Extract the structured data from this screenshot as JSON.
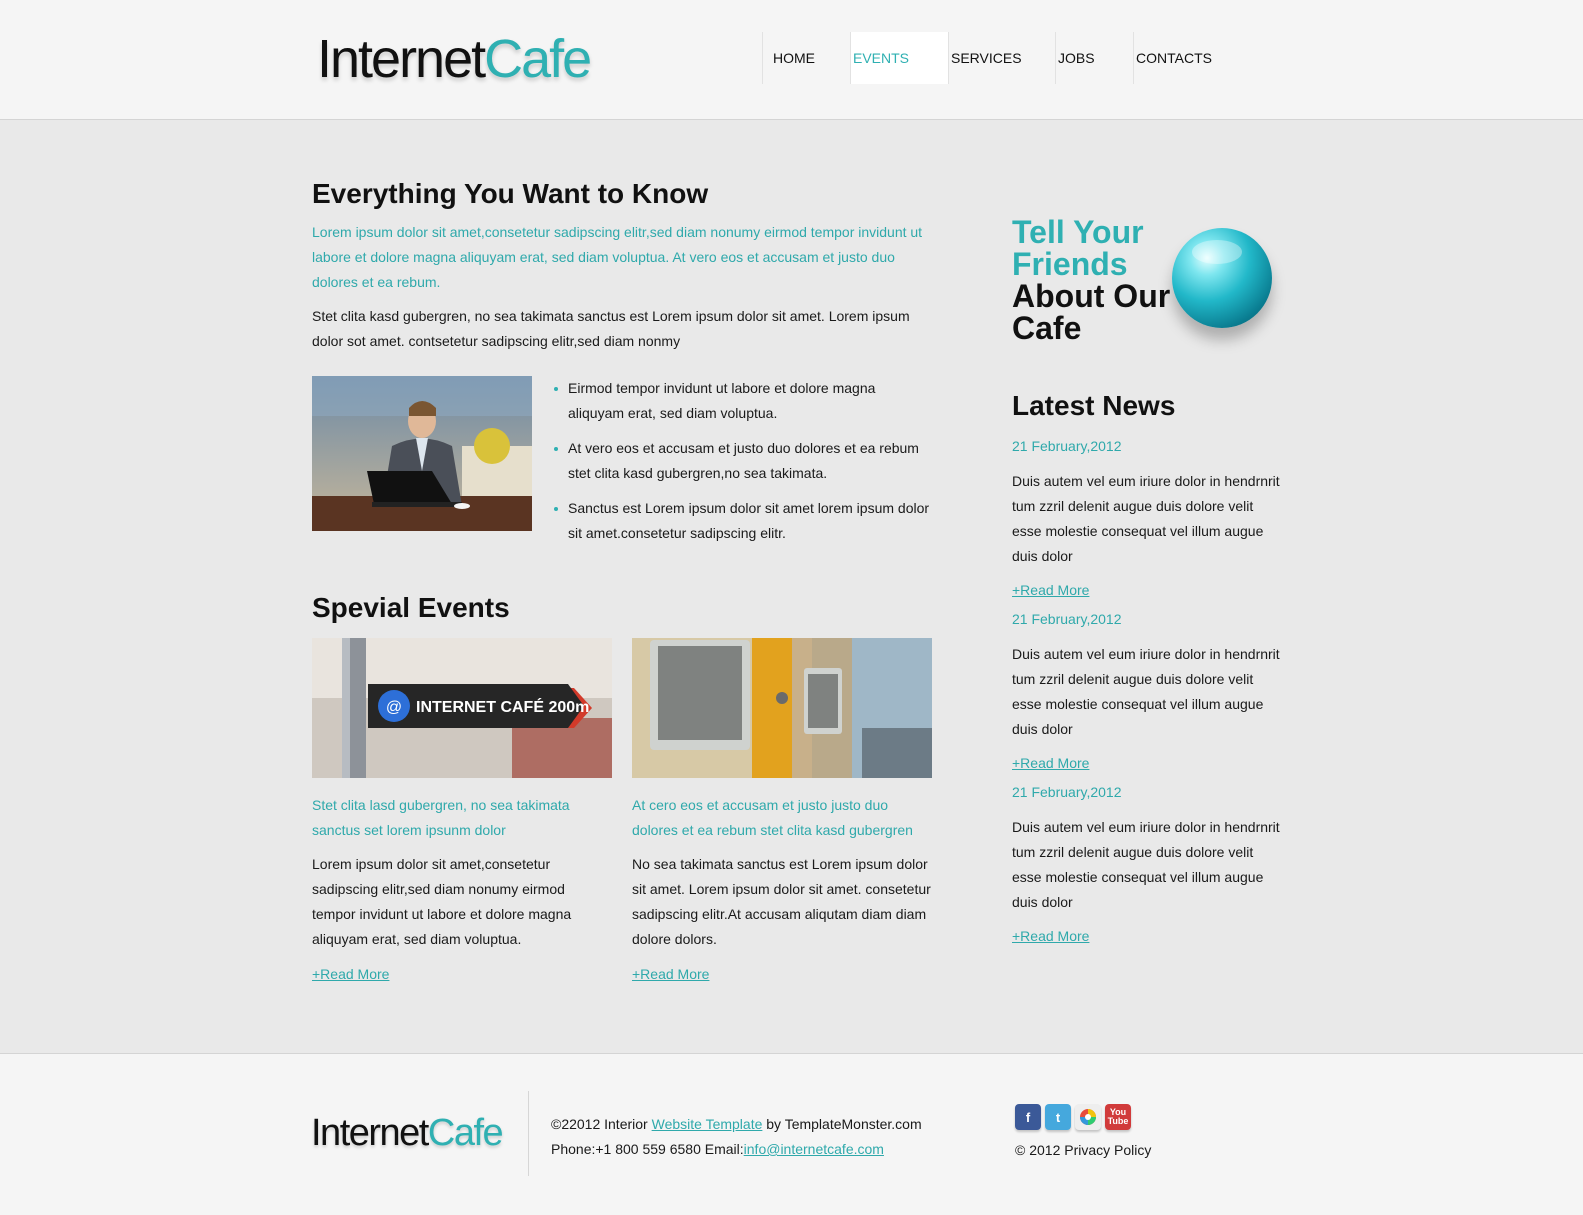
{
  "header": {
    "logo": {
      "part1": "Internet",
      "part2": "Cafe"
    },
    "nav": [
      {
        "label": "HOME"
      },
      {
        "label": "EVENTS"
      },
      {
        "label": "SERVICES"
      },
      {
        "label": "JOBS"
      },
      {
        "label": "CONTACTS"
      }
    ],
    "active_nav": "EVENTS"
  },
  "main": {
    "title": "Everything You Want to Know",
    "lead": "Lorem ipsum dolor sit amet,consetetur sadipscing elitr,sed diam nonumy eirmod tempor invidunt ut labore et dolore magna aliquyam erat, sed diam voluptua. At vero eos et accusam et justo duo dolores et ea rebum.",
    "paragraph": "Stet clita kasd gubergren, no sea takimata sanctus est Lorem ipsum dolor sit amet. Lorem ipsum dolor sot amet. contsetetur sadipscing elitr,sed diam nonmy",
    "bullets": [
      "Eirmod tempor invidunt ut labore et dolore magna aliquyam erat, sed diam voluptua.",
      "At vero eos et accusam et justo duo dolores et ea rebum stet clita kasd gubergren,no sea takimata.",
      "Sanctus est Lorem ipsum dolor sit amet lorem ipsum dolor sit amet.consetetur sadipscing elitr."
    ],
    "events_title": "Spevial Events",
    "events": [
      {
        "image_sign": "INTERNET CAFÉ 200m",
        "image_at": "@",
        "subtitle": "Stet clita lasd gubergren, no sea takimata sanctus set lorem ipsunm dolor",
        "text": "Lorem ipsum dolor sit amet,consetetur sadipscing elitr,sed diam nonumy eirmod tempor invidunt ut labore et dolore magna aliquyam erat, sed diam voluptua.",
        "read_more": "+Read More"
      },
      {
        "subtitle": "At cero eos et accusam et justo justo duo dolores et ea rebum stet clita kasd gubergren",
        "text": "No sea takimata sanctus est Lorem ipsum dolor sit amet. Lorem ipsum dolor sit amet. consetetur sadipscing elitr.At accusam aliqutam diam diam dolore dolors.",
        "read_more": "+Read More"
      }
    ]
  },
  "sidebar": {
    "tell_line1": "Tell Your",
    "tell_line2": "Friends",
    "tell_line3": "About Our",
    "tell_line4": "Cafe",
    "news_title": "Latest News",
    "news": [
      {
        "date": "21 February,2012",
        "text": "Duis autem vel eum iriure dolor in hendrnrit tum zzril delenit augue duis dolore velit esse molestie consequat vel illum augue duis dolor",
        "read_more": "+Read More"
      },
      {
        "date": "21 February,2012",
        "text": "Duis autem vel eum iriure dolor in hendrnrit tum zzril delenit augue duis dolore velit esse molestie consequat vel illum augue duis dolor",
        "read_more": "+Read More"
      },
      {
        "date": "21 February,2012",
        "text": "Duis autem vel eum iriure dolor in hendrnrit tum zzril delenit augue duis dolore velit esse molestie consequat vel illum augue duis dolor",
        "read_more": "+Read More"
      }
    ]
  },
  "footer": {
    "logo": {
      "part1": "Internet",
      "part2": "Cafe"
    },
    "copy_prefix": "©22012 Interior ",
    "copy_link": "Website Template",
    "copy_suffix": " by TemplateMonster.com",
    "phone_prefix": "Phone:+1 800 559 6580 Email:",
    "email": "info@internetcafe.com",
    "social": {
      "facebook": "f",
      "twitter": "t",
      "youtube_line1": "You",
      "youtube_line2": "Tube"
    },
    "privacy": "© 2012 Privacy Policy"
  },
  "colors": {
    "accent": "#2fb0b2",
    "text": "#111111",
    "background": "#e9e9e9"
  }
}
